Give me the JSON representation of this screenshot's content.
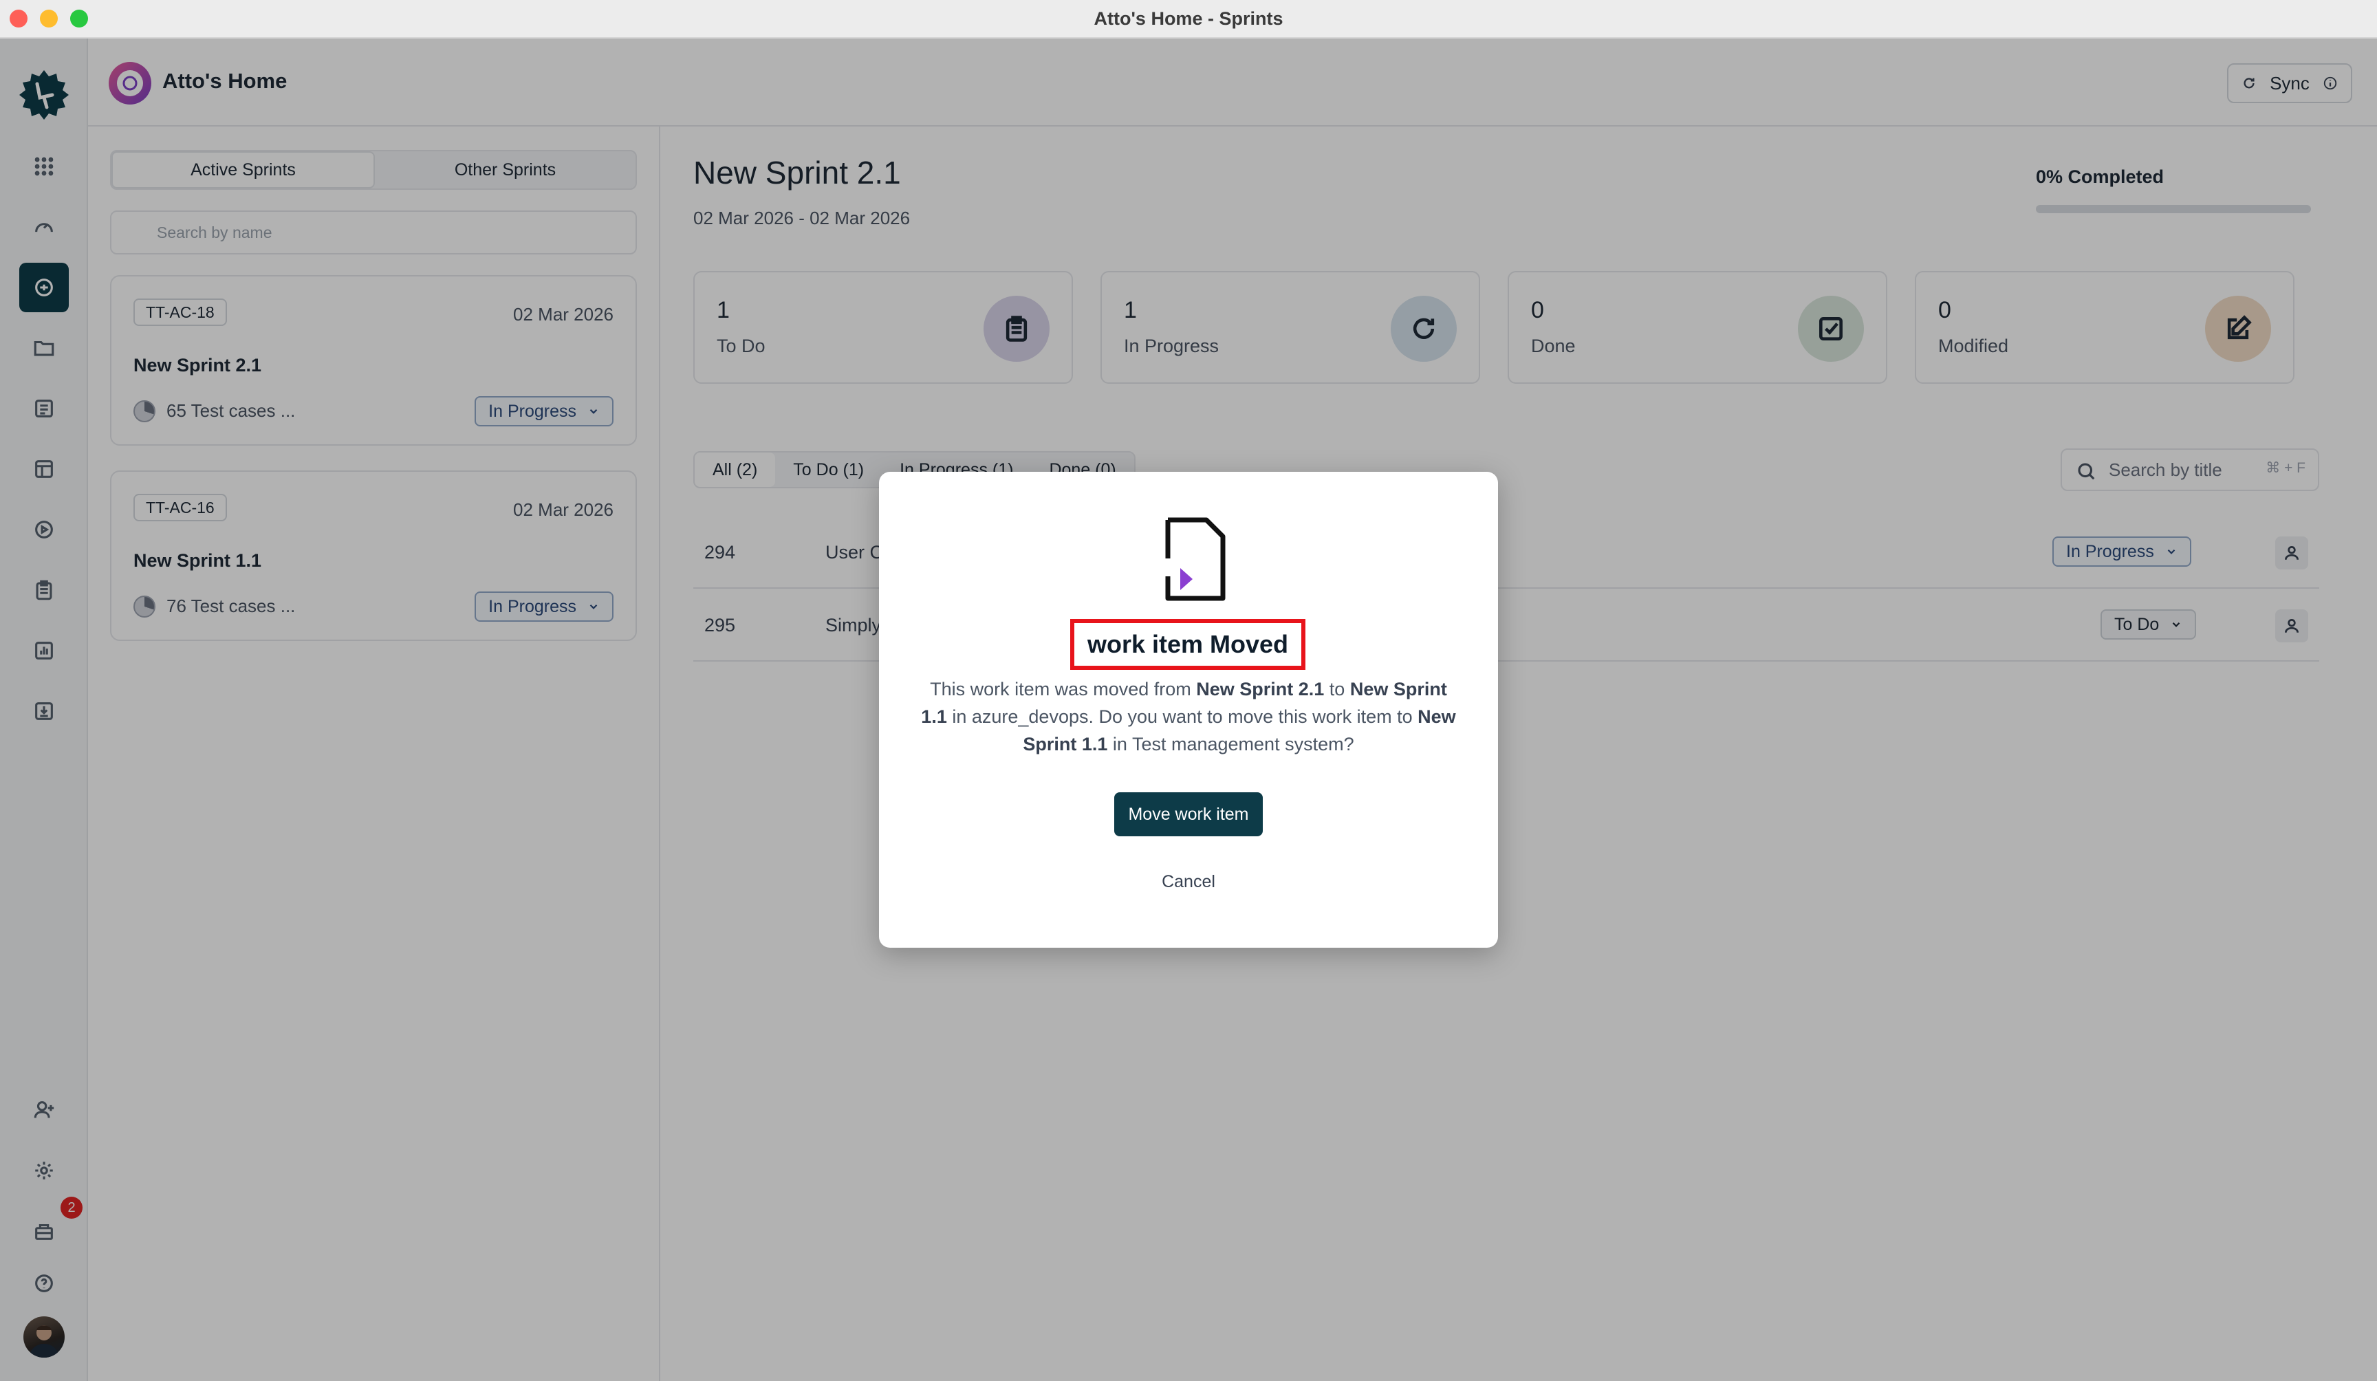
{
  "window": {
    "title": "Atto's Home - Sprints"
  },
  "header": {
    "title": "Atto's Home",
    "sync_label": "Sync"
  },
  "sidebar": {
    "notification_count": "2"
  },
  "sprint_tabs": {
    "active": "Active Sprints",
    "other": "Other Sprints"
  },
  "sprint_search": {
    "placeholder": "Search by name"
  },
  "sprints": [
    {
      "code": "TT-AC-18",
      "date": "02 Mar 2026",
      "name": "New Sprint 2.1",
      "test_cases": "65 Test cases ...",
      "status": "In Progress"
    },
    {
      "code": "TT-AC-16",
      "date": "02 Mar 2026",
      "name": "New Sprint 1.1",
      "test_cases": "76 Test cases ...",
      "status": "In Progress"
    }
  ],
  "detail": {
    "title": "New Sprint 2.1",
    "dates": "02 Mar 2026 - 02 Mar 2026",
    "completed_label": "0% Completed",
    "completed_fraction": 0,
    "stats": [
      {
        "value": "1",
        "label": "To Do",
        "icon": "clipboard-icon",
        "color": "#d9d4ea"
      },
      {
        "value": "1",
        "label": "In Progress",
        "icon": "refresh-icon",
        "color": "#d6e2ec"
      },
      {
        "value": "0",
        "label": "Done",
        "icon": "check-square-icon",
        "color": "#d8e6dc"
      },
      {
        "value": "0",
        "label": "Modified",
        "icon": "edit-icon",
        "color": "#f1dcc6"
      }
    ],
    "filters": [
      "All (2)",
      "To Do (1)",
      "In Progress (1)",
      "Done (0)"
    ],
    "search": {
      "placeholder": "Search by title",
      "shortcut": "⌘ + F"
    },
    "items": [
      {
        "id": "294",
        "title": "User C",
        "status": "In Progress"
      },
      {
        "id": "295",
        "title": "Simply",
        "status": "To Do"
      }
    ]
  },
  "modal": {
    "title": "work item Moved",
    "body_1": "This work item was moved from ",
    "from_sprint": "New Sprint 2.1",
    "body_2": " to ",
    "to_sprint": "New Sprint 1.1",
    "body_3": " in azure_devops. Do you want to move this work item to ",
    "target_sprint": "New Sprint 1.1",
    "body_4": " in Test management system?",
    "primary_label": "Move work item",
    "cancel_label": "Cancel"
  },
  "colors": {
    "accent": "#0d3b48",
    "highlight": "#e8141b"
  }
}
